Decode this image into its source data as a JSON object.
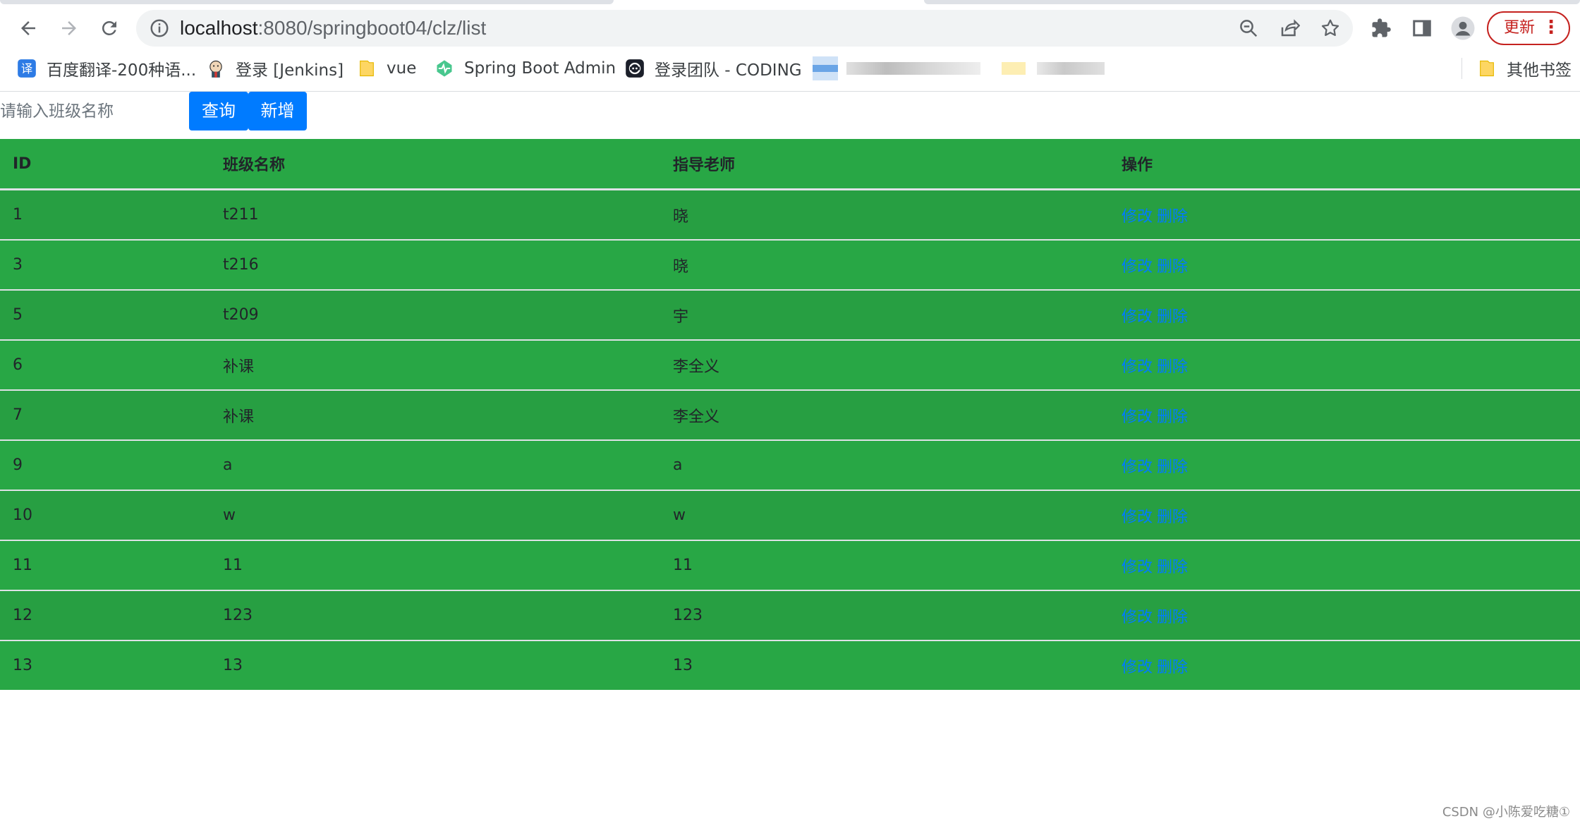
{
  "browser": {
    "url_host": "localhost",
    "url_rest": ":8080/springboot04/clz/list",
    "update_label": "更新",
    "bookmarks": [
      {
        "label": "百度翻译-200种语...",
        "icon": "translate-icon"
      },
      {
        "label": "登录 [Jenkins]",
        "icon": "jenkins-icon"
      },
      {
        "label": "vue",
        "icon": "folder-icon"
      },
      {
        "label": "Spring Boot Admin",
        "icon": "pulse-icon"
      },
      {
        "label": "登录团队 - CODING",
        "icon": "coding-icon"
      }
    ],
    "other_bookmarks": "其他书签"
  },
  "search": {
    "placeholder": "请输入班级名称",
    "query_label": "查询",
    "add_label": "新增"
  },
  "table": {
    "headers": [
      "ID",
      "班级名称",
      "指导老师",
      "操作"
    ],
    "rows": [
      {
        "id": "1",
        "name": "t211",
        "teacher": "晓"
      },
      {
        "id": "3",
        "name": "t216",
        "teacher": "晓"
      },
      {
        "id": "5",
        "name": "t209",
        "teacher": "宇"
      },
      {
        "id": "6",
        "name": "补课",
        "teacher": "李全义"
      },
      {
        "id": "7",
        "name": "补课",
        "teacher": "李全义"
      },
      {
        "id": "9",
        "name": "a",
        "teacher": "a"
      },
      {
        "id": "10",
        "name": "w",
        "teacher": "w"
      },
      {
        "id": "11",
        "name": "11",
        "teacher": "11"
      },
      {
        "id": "12",
        "name": "123",
        "teacher": "123"
      },
      {
        "id": "13",
        "name": "13",
        "teacher": "13"
      }
    ],
    "edit_label": "修改",
    "delete_label": "删除"
  },
  "watermark": "CSDN @小陈爱吃糖①",
  "colors": {
    "table_bg": "#28a745",
    "button_bg": "#007bff",
    "link": "#007bff",
    "update_red": "#c5221f"
  }
}
